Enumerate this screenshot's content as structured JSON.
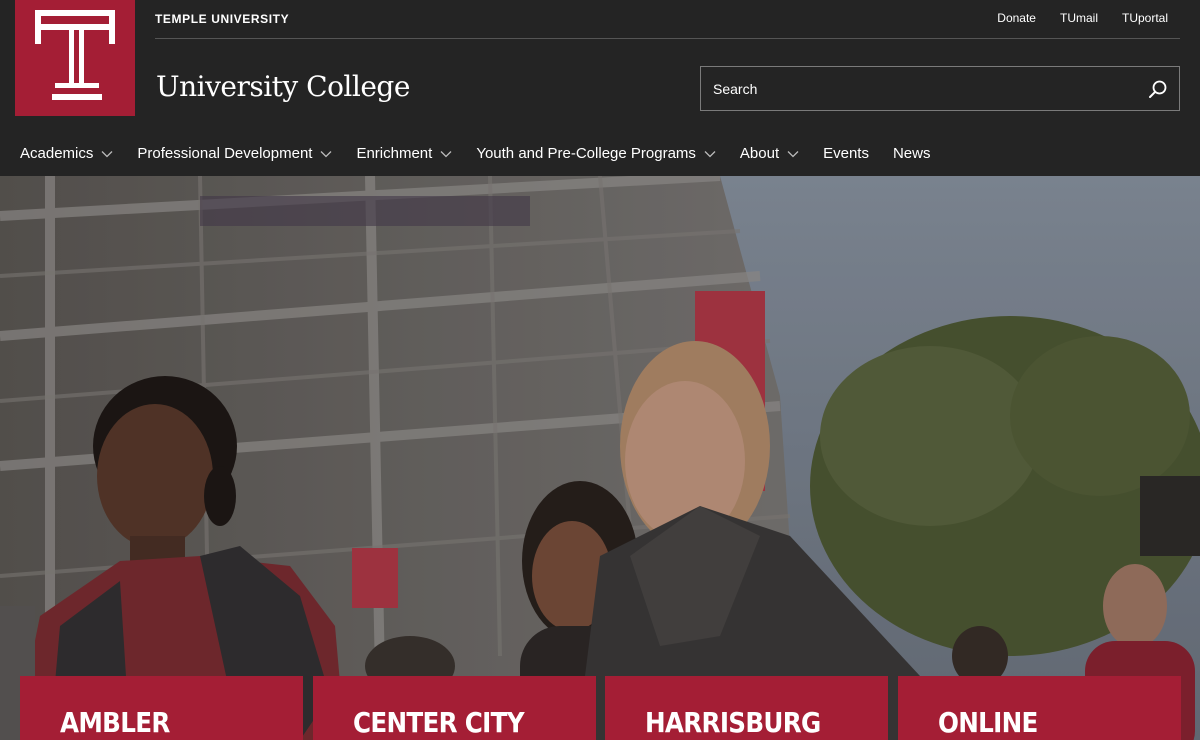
{
  "header": {
    "university_name": "TEMPLE UNIVERSITY",
    "site_title": "University College",
    "utility_links": [
      {
        "label": "Donate"
      },
      {
        "label": "TUmail"
      },
      {
        "label": "TUportal"
      }
    ],
    "search": {
      "placeholder": "Search"
    }
  },
  "nav": {
    "items": [
      {
        "label": "Academics",
        "dropdown": true
      },
      {
        "label": "Professional Development",
        "dropdown": true
      },
      {
        "label": "Enrichment",
        "dropdown": true
      },
      {
        "label": "Youth and Pre-College Programs",
        "dropdown": true
      },
      {
        "label": "About",
        "dropdown": true
      },
      {
        "label": "Events",
        "dropdown": false
      },
      {
        "label": "News",
        "dropdown": false
      }
    ]
  },
  "campuses": [
    {
      "label": "AMBLER"
    },
    {
      "label": "CENTER CITY"
    },
    {
      "label": "HARRISBURG"
    },
    {
      "label": "ONLINE"
    }
  ],
  "colors": {
    "brand": "#a41e35",
    "header_bg": "#242424"
  },
  "icons": {
    "logo": "temple-t-logo",
    "search": "search-icon",
    "dropdown": "chevron-down-icon"
  }
}
